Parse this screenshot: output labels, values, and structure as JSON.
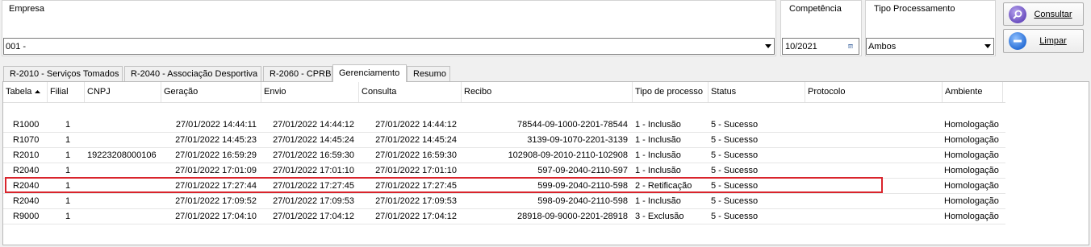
{
  "filters": {
    "empresa": {
      "label": "Empresa",
      "value": "001 -"
    },
    "competencia": {
      "label": "Competência",
      "value": "10/2021"
    },
    "tipo_processamento": {
      "label": "Tipo Processamento",
      "value": "Ambos"
    }
  },
  "buttons": {
    "consultar": "Consultar",
    "limpar": "Limpar"
  },
  "tabs": [
    {
      "label": "R-2010 - Serviços Tomados"
    },
    {
      "label": "R-2040 - Associação Desportiva"
    },
    {
      "label": "R-2060 - CPRB"
    },
    {
      "label": "Gerenciamento",
      "active": true
    },
    {
      "label": "Resumo"
    }
  ],
  "grid": {
    "columns": [
      "Tabela",
      "Filial",
      "CNPJ",
      "Geração",
      "Envio",
      "Consulta",
      "Recibo",
      "Tipo de processo",
      "Status",
      "Protocolo",
      "Ambiente"
    ],
    "rows": [
      [
        "R1000",
        "1",
        "",
        "27/01/2022 14:44:11",
        "27/01/2022 14:44:12",
        "27/01/2022 14:44:12",
        "78544-09-1000-2201-78544",
        "1 - Inclusão",
        "5 - Sucesso",
        "",
        "Homologação"
      ],
      [
        "R1070",
        "1",
        "",
        "27/01/2022 14:45:23",
        "27/01/2022 14:45:24",
        "27/01/2022 14:45:24",
        "3139-09-1070-2201-3139",
        "1 - Inclusão",
        "5 - Sucesso",
        "",
        "Homologação"
      ],
      [
        "R2010",
        "1",
        "19223208000106",
        "27/01/2022 16:59:29",
        "27/01/2022 16:59:30",
        "27/01/2022 16:59:30",
        "102908-09-2010-2110-102908",
        "1 - Inclusão",
        "5 - Sucesso",
        "",
        "Homologação"
      ],
      [
        "R2040",
        "1",
        "",
        "27/01/2022 17:01:09",
        "27/01/2022 17:01:10",
        "27/01/2022 17:01:10",
        "597-09-2040-2110-597",
        "1 - Inclusão",
        "5 - Sucesso",
        "",
        "Homologação"
      ],
      [
        "R2040",
        "1",
        "",
        "27/01/2022 17:27:44",
        "27/01/2022 17:27:45",
        "27/01/2022 17:27:45",
        "599-09-2040-2110-598",
        "2 - Retificação",
        "5 - Sucesso",
        "",
        "Homologação"
      ],
      [
        "R2040",
        "1",
        "",
        "27/01/2022 17:09:52",
        "27/01/2022 17:09:53",
        "27/01/2022 17:09:53",
        "598-09-2040-2110-598",
        "1 - Inclusão",
        "5 - Sucesso",
        "",
        "Homologação"
      ],
      [
        "R9000",
        "1",
        "",
        "27/01/2022 17:04:10",
        "27/01/2022 17:04:12",
        "27/01/2022 17:04:12",
        "28918-09-9000-2201-28918",
        "3 - Exclusão",
        "5 - Sucesso",
        "",
        "Homologação"
      ]
    ]
  },
  "colors": {
    "highlight": "#d9242c",
    "consultar_icon": "#6b4fbf",
    "limpar_icon": "#2a6fd6"
  },
  "icons": {
    "consultar": "magnifier-icon",
    "limpar": "minus-circle-icon",
    "calendar": "calendar-icon"
  }
}
